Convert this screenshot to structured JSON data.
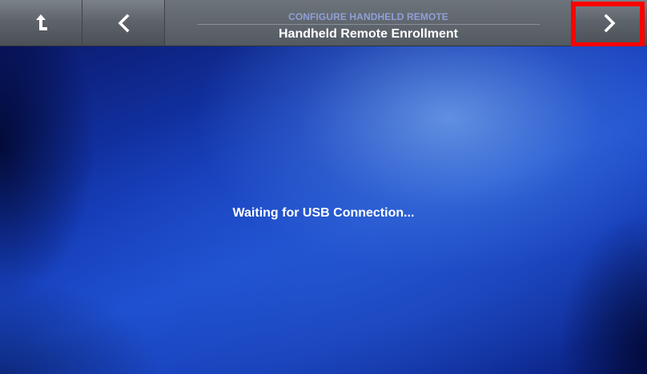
{
  "header": {
    "subtitle": "CONFIGURE HANDHELD REMOTE",
    "title": "Handheld Remote Enrollment",
    "up_icon": "up-arrow-icon",
    "back_icon": "chevron-left-icon",
    "next_icon": "chevron-right-icon"
  },
  "main": {
    "status_text": "Waiting for USB Connection..."
  },
  "colors": {
    "highlight": "#ff0000",
    "background": "#1a46c4",
    "subtitle": "#8fa0d8"
  }
}
